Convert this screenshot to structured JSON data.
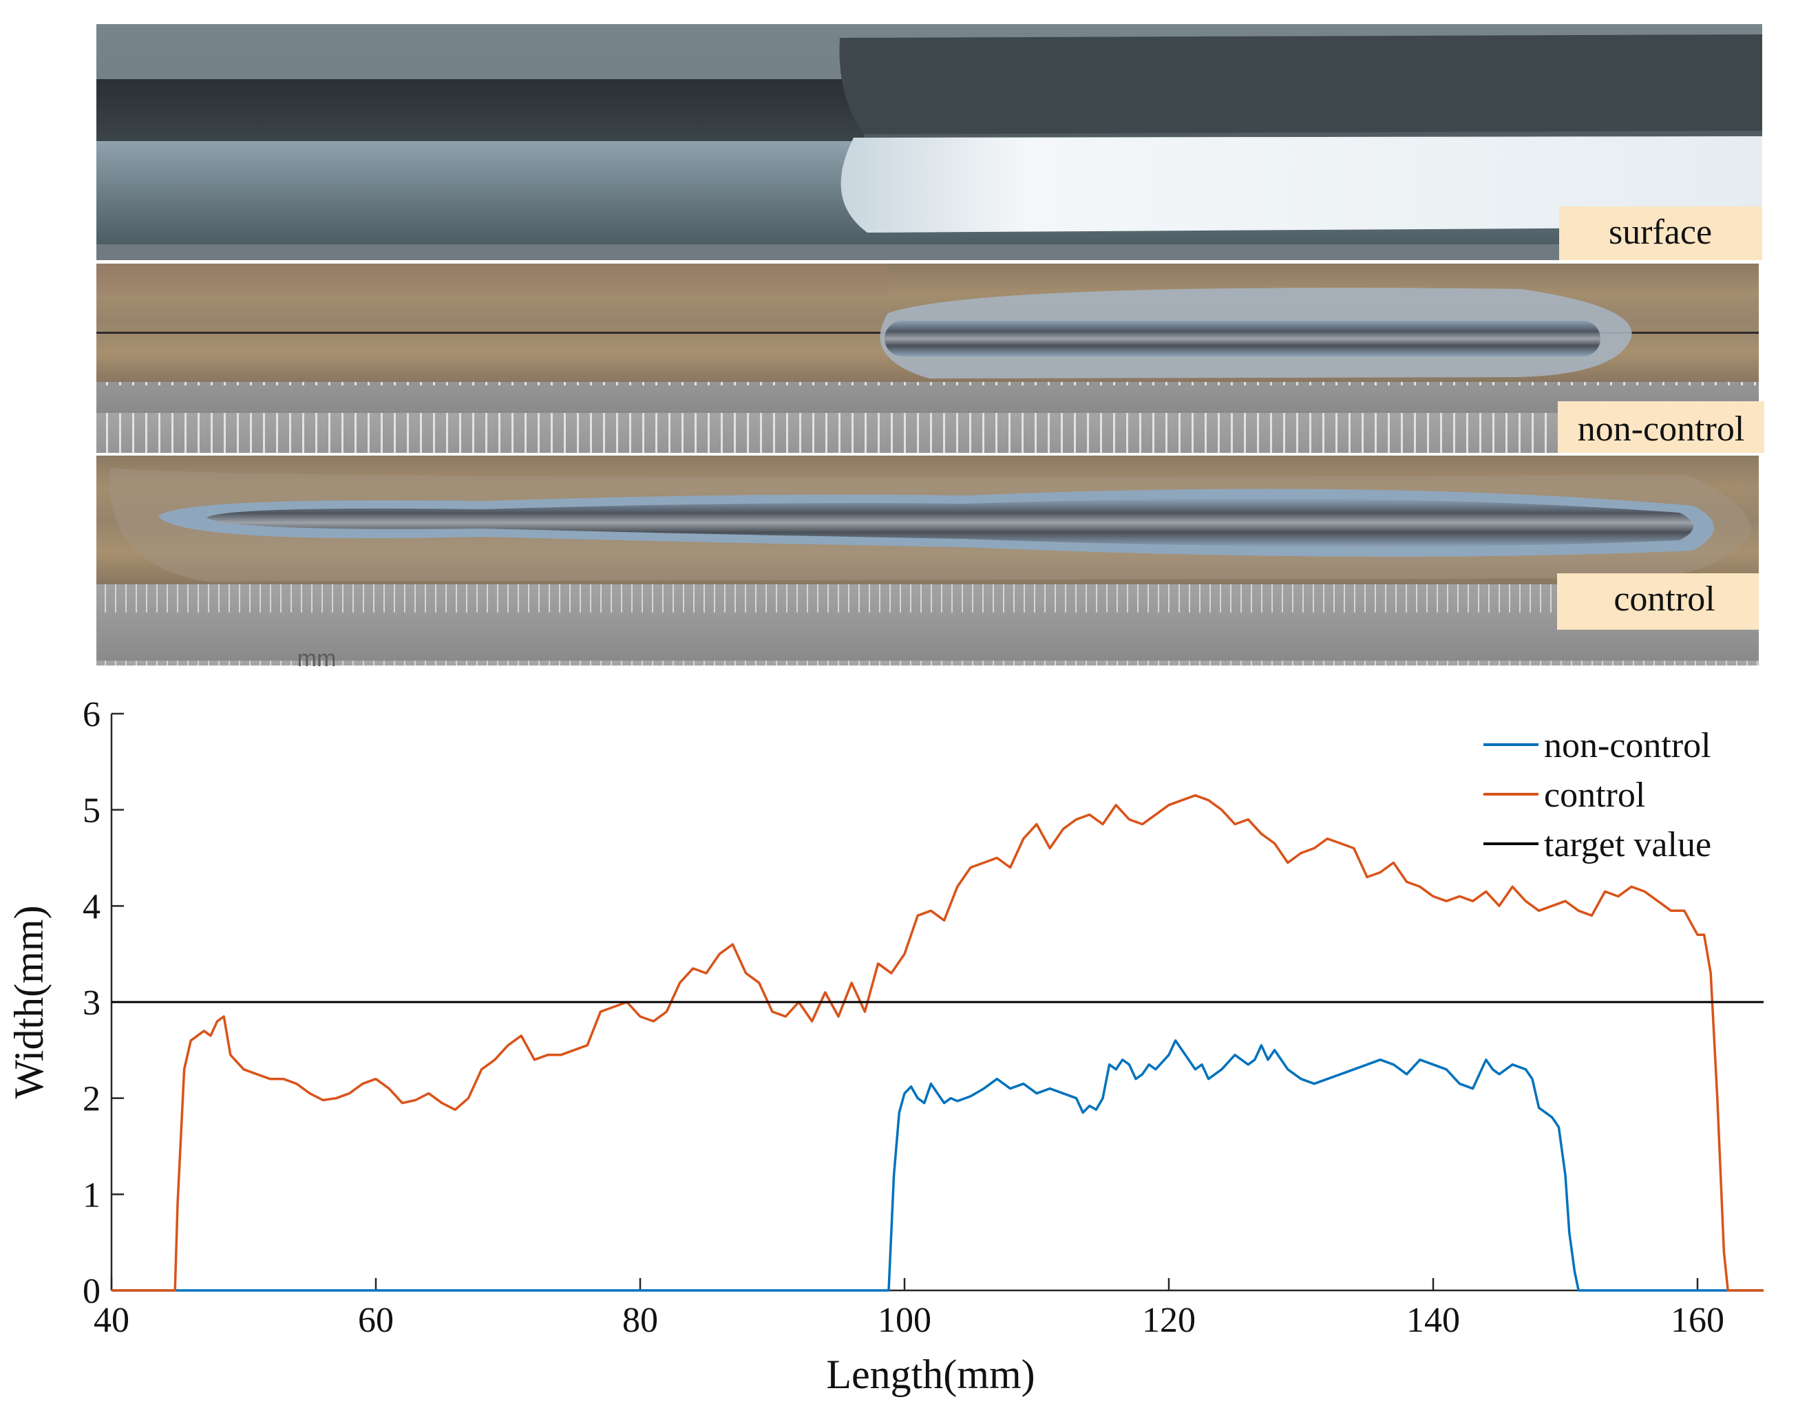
{
  "panels": {
    "surface": "surface",
    "non_control": "non-control",
    "control": "control",
    "ruler_unit": "mm"
  },
  "chart_data": {
    "type": "line",
    "xlabel": "Length(mm)",
    "ylabel": "Width(mm)",
    "xlim": [
      40,
      165
    ],
    "ylim": [
      0,
      6
    ],
    "xticks": [
      40,
      60,
      80,
      100,
      120,
      140,
      160
    ],
    "yticks": [
      0,
      1,
      2,
      3,
      4,
      5,
      6
    ],
    "legend_position": "top-right",
    "series": [
      {
        "name": "non-control",
        "color": "#0072BD",
        "x": [
          40,
          98.8,
          99.2,
          99.6,
          100,
          100.5,
          101,
          101.5,
          102,
          102.5,
          103,
          103.5,
          104,
          105,
          106,
          107,
          108,
          109,
          110,
          111,
          112,
          113,
          113.5,
          114,
          114.5,
          115,
          115.5,
          116,
          116.5,
          117,
          117.5,
          118,
          118.5,
          119,
          120,
          120.5,
          121,
          121.5,
          122,
          122.5,
          123,
          124,
          125,
          126,
          126.5,
          127,
          127.5,
          128,
          129,
          130,
          131,
          132,
          133,
          134,
          135,
          136,
          137,
          138,
          139,
          140,
          141,
          142,
          143,
          144,
          144.5,
          145,
          146,
          147,
          147.5,
          148,
          149,
          149.5,
          150,
          150.3,
          150.7,
          151,
          165
        ],
        "y": [
          0,
          0,
          1.2,
          1.85,
          2.05,
          2.12,
          2.0,
          1.95,
          2.15,
          2.05,
          1.95,
          2.0,
          1.97,
          2.02,
          2.1,
          2.2,
          2.1,
          2.15,
          2.05,
          2.1,
          2.05,
          2.0,
          1.85,
          1.92,
          1.88,
          2.0,
          2.35,
          2.3,
          2.4,
          2.35,
          2.2,
          2.25,
          2.35,
          2.3,
          2.45,
          2.6,
          2.5,
          2.4,
          2.3,
          2.35,
          2.2,
          2.3,
          2.45,
          2.35,
          2.4,
          2.55,
          2.4,
          2.5,
          2.3,
          2.2,
          2.15,
          2.2,
          2.25,
          2.3,
          2.35,
          2.4,
          2.35,
          2.25,
          2.4,
          2.35,
          2.3,
          2.15,
          2.1,
          2.4,
          2.3,
          2.25,
          2.35,
          2.3,
          2.2,
          1.9,
          1.8,
          1.7,
          1.2,
          0.6,
          0.2,
          0,
          0
        ]
      },
      {
        "name": "control",
        "color": "#D95319",
        "x": [
          40,
          44.8,
          45,
          45.5,
          46,
          46.5,
          47,
          47.5,
          48,
          48.5,
          49,
          50,
          51,
          52,
          53,
          54,
          55,
          56,
          57,
          58,
          59,
          60,
          61,
          62,
          63,
          64,
          65,
          66,
          67,
          68,
          69,
          70,
          71,
          72,
          73,
          74,
          75,
          76,
          77,
          78,
          79,
          80,
          81,
          82,
          83,
          84,
          85,
          86,
          87,
          88,
          89,
          90,
          91,
          92,
          93,
          94,
          95,
          96,
          97,
          98,
          99,
          100,
          101,
          102,
          103,
          104,
          105,
          106,
          107,
          108,
          109,
          110,
          111,
          112,
          113,
          114,
          115,
          116,
          117,
          118,
          119,
          120,
          121,
          122,
          123,
          124,
          125,
          126,
          127,
          128,
          129,
          130,
          131,
          132,
          133,
          134,
          135,
          136,
          137,
          138,
          139,
          140,
          141,
          142,
          143,
          144,
          145,
          146,
          147,
          148,
          149,
          150,
          151,
          152,
          153,
          154,
          155,
          156,
          157,
          158,
          159,
          160,
          160.5,
          161,
          161.5,
          162,
          162.3,
          165
        ],
        "y": [
          0,
          0,
          0.9,
          2.3,
          2.6,
          2.65,
          2.7,
          2.65,
          2.8,
          2.85,
          2.45,
          2.3,
          2.25,
          2.2,
          2.2,
          2.15,
          2.05,
          1.98,
          2.0,
          2.05,
          2.15,
          2.2,
          2.1,
          1.95,
          1.98,
          2.05,
          1.95,
          1.88,
          2.0,
          2.3,
          2.4,
          2.55,
          2.65,
          2.4,
          2.45,
          2.45,
          2.5,
          2.55,
          2.9,
          2.95,
          3.0,
          2.85,
          2.8,
          2.9,
          3.2,
          3.35,
          3.3,
          3.5,
          3.6,
          3.3,
          3.2,
          2.9,
          2.85,
          3.0,
          2.8,
          3.1,
          2.85,
          3.2,
          2.9,
          3.4,
          3.3,
          3.5,
          3.9,
          3.95,
          3.85,
          4.2,
          4.4,
          4.45,
          4.5,
          4.4,
          4.7,
          4.85,
          4.6,
          4.8,
          4.9,
          4.95,
          4.85,
          5.05,
          4.9,
          4.85,
          4.95,
          5.05,
          5.1,
          5.15,
          5.1,
          5.0,
          4.85,
          4.9,
          4.75,
          4.65,
          4.45,
          4.55,
          4.6,
          4.7,
          4.65,
          4.6,
          4.3,
          4.35,
          4.45,
          4.25,
          4.2,
          4.1,
          4.05,
          4.1,
          4.05,
          4.15,
          4.0,
          4.2,
          4.05,
          3.95,
          4.0,
          4.05,
          3.95,
          3.9,
          4.15,
          4.1,
          4.2,
          4.15,
          4.05,
          3.95,
          3.95,
          3.7,
          3.7,
          3.3,
          2.0,
          0.4,
          0,
          0
        ]
      },
      {
        "name": "target value",
        "color": "#000000",
        "x": [
          40,
          165
        ],
        "y": [
          3,
          3
        ]
      }
    ]
  }
}
